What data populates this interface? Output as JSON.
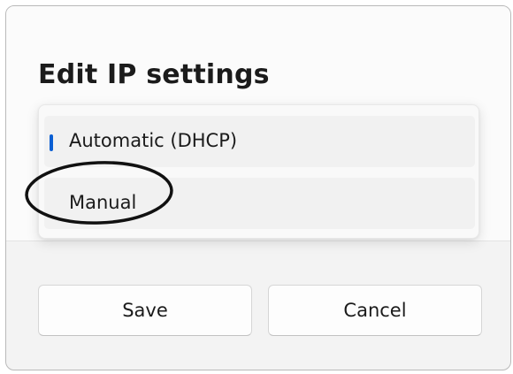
{
  "dialog": {
    "title": "Edit IP settings"
  },
  "dropdown": {
    "options": [
      {
        "label": "Automatic (DHCP)",
        "selected": true
      },
      {
        "label": "Manual",
        "selected": false
      }
    ]
  },
  "buttons": {
    "save_label": "Save",
    "cancel_label": "Cancel"
  },
  "colors": {
    "accent": "#0a5fd3",
    "annotation": "#111111"
  }
}
